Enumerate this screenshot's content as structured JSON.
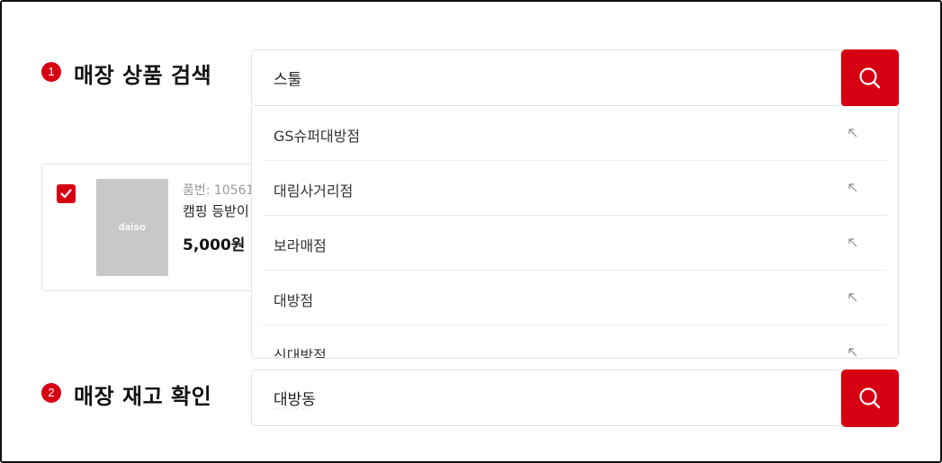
{
  "section1": {
    "step": "1",
    "title": "매장 상품 검색",
    "search_value": "스툴"
  },
  "section2": {
    "step": "2",
    "title": "매장 재고 확인",
    "search_value": "대방동"
  },
  "product": {
    "number_label": "품번: 10561",
    "name": "캠핑 등받이",
    "price": "5,000원",
    "thumb_text": "daiso",
    "checked": true
  },
  "suggestions": [
    {
      "label": "GS슈퍼대방점"
    },
    {
      "label": "대림사거리점"
    },
    {
      "label": "보라매점"
    },
    {
      "label": "대방점"
    },
    {
      "label": "신대방점"
    }
  ],
  "colors": {
    "accent": "#d60012",
    "border": "#e2e2e2",
    "thumb": "#c8c8c8"
  },
  "icons": {
    "search": "search-icon",
    "suggestion_arrow": "arrow-up-left-icon",
    "check": "check-icon"
  }
}
